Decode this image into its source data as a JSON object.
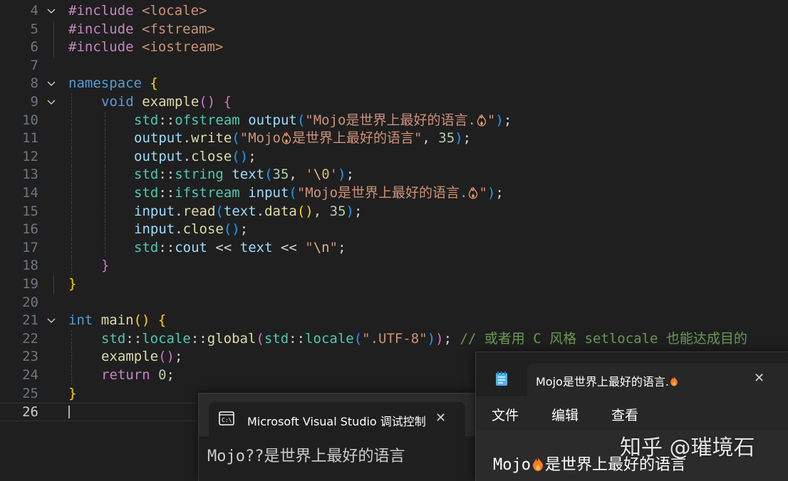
{
  "editor": {
    "active_line": "26",
    "lines": [
      {
        "n": "4",
        "fold": true
      },
      {
        "n": "5"
      },
      {
        "n": "6"
      },
      {
        "n": "7"
      },
      {
        "n": "8",
        "fold": true
      },
      {
        "n": "9",
        "fold": true
      },
      {
        "n": "10"
      },
      {
        "n": "11"
      },
      {
        "n": "12"
      },
      {
        "n": "13"
      },
      {
        "n": "14"
      },
      {
        "n": "15"
      },
      {
        "n": "16"
      },
      {
        "n": "17"
      },
      {
        "n": "18"
      },
      {
        "n": "19"
      },
      {
        "n": "20"
      },
      {
        "n": "21",
        "fold": true
      },
      {
        "n": "22"
      },
      {
        "n": "23"
      },
      {
        "n": "24"
      },
      {
        "n": "25"
      },
      {
        "n": "26"
      }
    ],
    "tokens": {
      "l4_pre": "#include",
      "l4_inc": "<locale>",
      "l5_pre": "#include",
      "l5_inc": "<fstream>",
      "l6_pre": "#include",
      "l6_inc": "<iostream>",
      "l8_kw": "namespace",
      "l8_b": "{",
      "l9_kw": "void",
      "l9_fn": "example",
      "l9_p": "()",
      "l9_b": "{",
      "l10_ns": "std",
      "l10_sep": "::",
      "l10_type": "ofstream",
      "l10_var": "output",
      "l10_po": "(",
      "l10_str": "\"Mojo是世界上最好的语言.",
      "l10_str2": "\"",
      "l10_pc": ")",
      "l10_end": ";",
      "l11_var": "output",
      "l11_dot": ".",
      "l11_fn": "write",
      "l11_po": "(",
      "l11_str": "\"Mojo",
      "l11_str2": "是世界上最好的语言\"",
      "l11_comma": ", ",
      "l11_num": "35",
      "l11_pc": ")",
      "l11_end": ";",
      "l12_var": "output",
      "l12_dot": ".",
      "l12_fn": "close",
      "l12_p": "()",
      "l12_end": ";",
      "l13_ns": "std",
      "l13_sep": "::",
      "l13_type": "string",
      "l13_var": "text",
      "l13_po": "(",
      "l13_num": "35",
      "l13_comma": ", ",
      "l13_str": "'",
      "l13_esc": "\\0",
      "l13_str2": "'",
      "l13_pc": ")",
      "l13_end": ";",
      "l14_ns": "std",
      "l14_sep": "::",
      "l14_type": "ifstream",
      "l14_var": "input",
      "l14_po": "(",
      "l14_str": "\"Mojo是世界上最好的语言.",
      "l14_str2": "\"",
      "l14_pc": ")",
      "l14_end": ";",
      "l15_var": "input",
      "l15_dot": ".",
      "l15_fn": "read",
      "l15_po": "(",
      "l15_var2": "text",
      "l15_dot2": ".",
      "l15_fn2": "data",
      "l15_p2": "()",
      "l15_comma": ", ",
      "l15_num": "35",
      "l15_pc": ")",
      "l15_end": ";",
      "l16_var": "input",
      "l16_dot": ".",
      "l16_fn": "close",
      "l16_p": "()",
      "l16_end": ";",
      "l17_ns": "std",
      "l17_sep": "::",
      "l17_var": "cout",
      "l17_op": " << ",
      "l17_var2": "text",
      "l17_op2": " << ",
      "l17_str": "\"",
      "l17_esc": "\\n",
      "l17_str2": "\"",
      "l17_end": ";",
      "l18_b": "}",
      "l19_b": "}",
      "l21_kw": "int",
      "l21_fn": "main",
      "l21_p": "()",
      "l21_b": "{",
      "l22_ns": "std",
      "l22_sep": "::",
      "l22_ns2": "locale",
      "l22_sep2": "::",
      "l22_fn": "global",
      "l22_po": "(",
      "l22_ns3": "std",
      "l22_sep3": "::",
      "l22_fn2": "locale",
      "l22_po2": "(",
      "l22_str": "\".UTF-8\"",
      "l22_pc2": ")",
      "l22_pc": ")",
      "l22_end": ";",
      "l22_cmt": " // 或者用 C 风格 setlocale 也能达成目的",
      "l23_fn": "example",
      "l23_p": "()",
      "l23_end": ";",
      "l24_kw": "return",
      "l24_num": "0",
      "l24_end": ";",
      "l25_b": "}"
    }
  },
  "console_window": {
    "title": "Microsoft Visual Studio 调试控制台",
    "icon": "console-icon",
    "close": "✕",
    "output": "Mojo??是世界上最好的语言"
  },
  "notepad_window": {
    "title": "Mojo是世界上最好的语言.",
    "icon": "notepad-icon",
    "close": "✕",
    "menu": [
      "文件",
      "编辑",
      "查看"
    ],
    "text_prefix": "Mojo",
    "text_suffix": "是世界上最好的语言"
  },
  "watermark": "知乎 @璀境石",
  "colors": {
    "editor_bg": "#1f1f1f",
    "keyword": "#569cd6",
    "string": "#ce9178",
    "function": "#dcdcaa",
    "variable": "#9cdcfe",
    "type": "#4ec9b0",
    "comment": "#6a9955",
    "flame": "#ff7a2a"
  }
}
